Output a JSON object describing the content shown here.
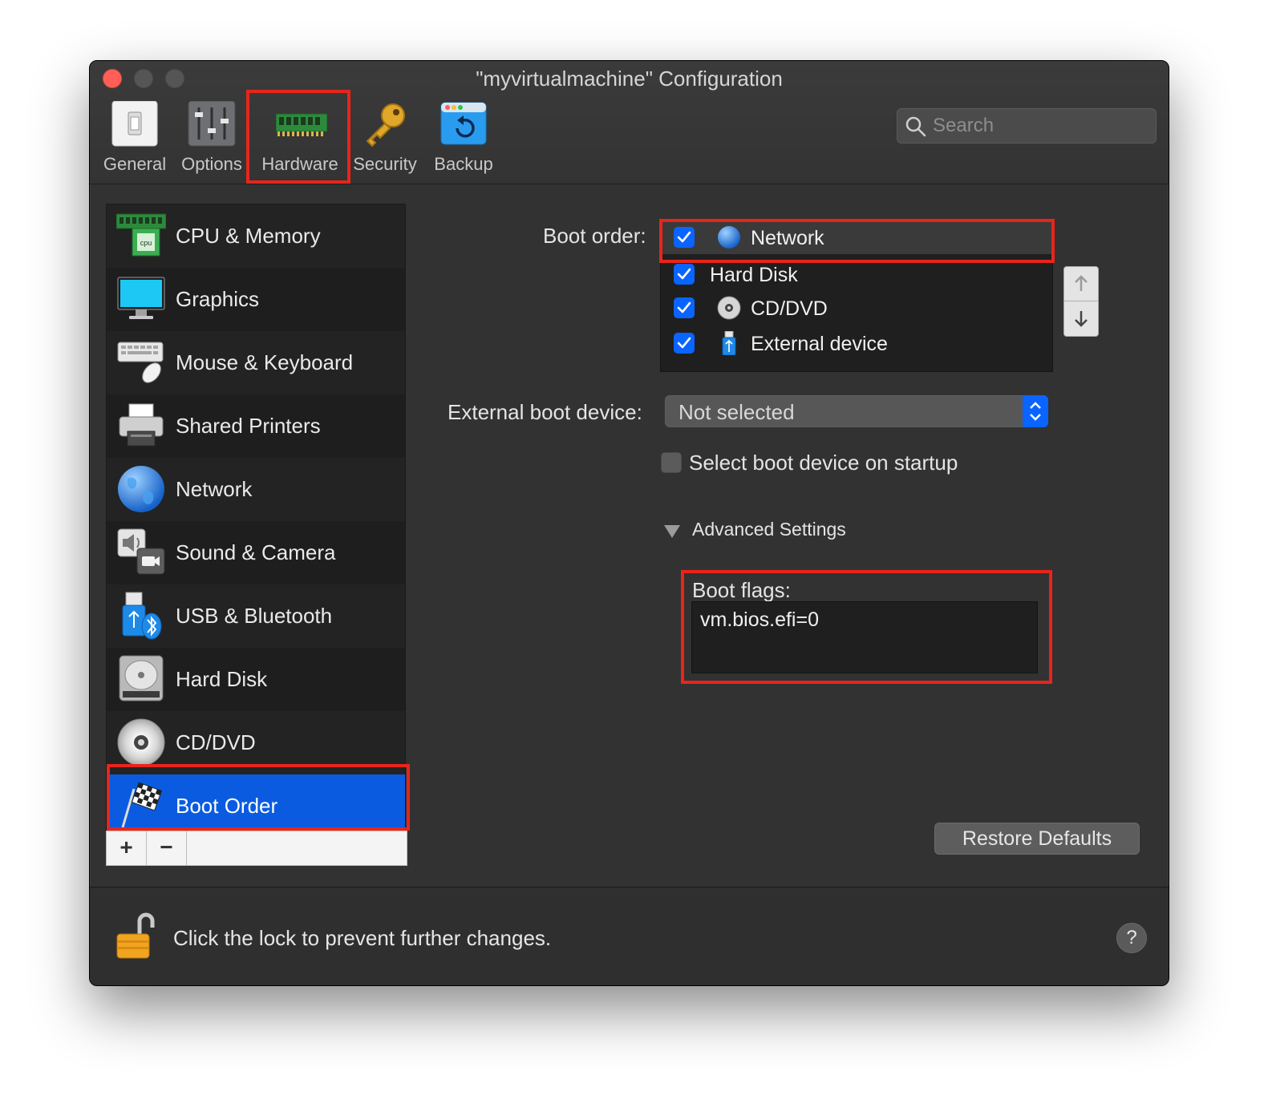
{
  "window": {
    "title": "\"myvirtualmachine\" Configuration"
  },
  "toolbar": {
    "items": [
      {
        "label": "General",
        "icon": "general-switch-icon"
      },
      {
        "label": "Options",
        "icon": "sliders-icon"
      },
      {
        "label": "Hardware",
        "icon": "ram-chip-icon",
        "selected": true
      },
      {
        "label": "Security",
        "icon": "key-icon"
      },
      {
        "label": "Backup",
        "icon": "backup-restore-icon"
      }
    ],
    "search_placeholder": "Search"
  },
  "sidebar": {
    "items": [
      {
        "label": "CPU & Memory",
        "icon": "cpu-chip-icon"
      },
      {
        "label": "Graphics",
        "icon": "monitor-icon"
      },
      {
        "label": "Mouse & Keyboard",
        "icon": "keyboard-mouse-icon"
      },
      {
        "label": "Shared Printers",
        "icon": "printer-icon"
      },
      {
        "label": "Network",
        "icon": "globe-icon"
      },
      {
        "label": "Sound & Camera",
        "icon": "speaker-camera-icon"
      },
      {
        "label": "USB & Bluetooth",
        "icon": "usb-bluetooth-icon"
      },
      {
        "label": "Hard Disk",
        "icon": "hard-disk-icon"
      },
      {
        "label": "CD/DVD",
        "icon": "disc-icon"
      },
      {
        "label": "Boot Order",
        "icon": "checkered-flag-icon",
        "selected": true
      }
    ],
    "add_label": "+",
    "remove_label": "−"
  },
  "boot": {
    "order_label": "Boot order:",
    "devices": [
      {
        "label": "Network",
        "checked": true,
        "icon": "globe-icon"
      },
      {
        "label": "Hard Disk",
        "checked": true,
        "icon": ""
      },
      {
        "label": "CD/DVD",
        "checked": true,
        "icon": "disc-icon"
      },
      {
        "label": "External device",
        "checked": true,
        "icon": "usb-stick-icon"
      }
    ],
    "external_label": "External boot device:",
    "external_value": "Not selected",
    "startup_label": "Select boot device on startup",
    "startup_checked": false,
    "advanced_label": "Advanced Settings",
    "flags_label": "Boot flags:",
    "flags_value": "vm.bios.efi=0",
    "restore_label": "Restore Defaults"
  },
  "footer": {
    "lock_text": "Click the lock to prevent further changes.",
    "help_label": "?"
  },
  "colors": {
    "accent": "#0a64ff",
    "selection": "#0a5be0",
    "highlight_box": "#e8251b",
    "close_button": "#ff5f57"
  }
}
